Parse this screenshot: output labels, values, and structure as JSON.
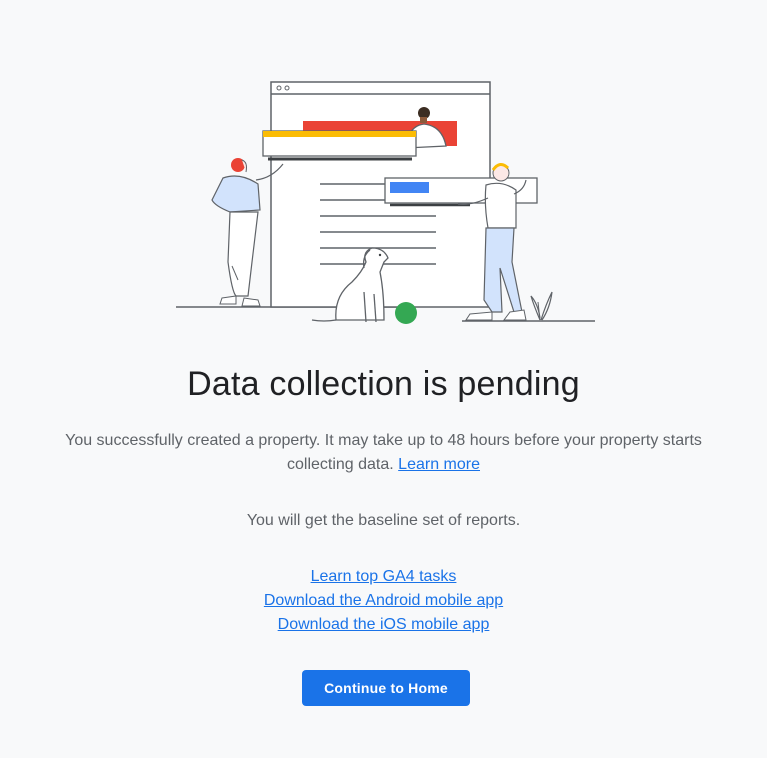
{
  "title": "Data collection is pending",
  "description": {
    "text": "You successfully created a property. It may take up to 48 hours before your property starts collecting data.",
    "link": "Learn more"
  },
  "baseline": "You will get the baseline set of reports.",
  "links": [
    {
      "label": "Learn top GA4 tasks"
    },
    {
      "label": "Download the Android mobile app"
    },
    {
      "label": "Download the iOS mobile app"
    }
  ],
  "cta": {
    "label": "Continue to Home"
  },
  "colors": {
    "primary": "#1a73e8",
    "red": "#ea4335",
    "yellow": "#fbbc04",
    "green": "#34a853",
    "blue": "#4285f4"
  },
  "icons": [
    "browser-window-illustration",
    "people-illustration",
    "dog-illustration",
    "plant-icon",
    "ball-icon"
  ]
}
